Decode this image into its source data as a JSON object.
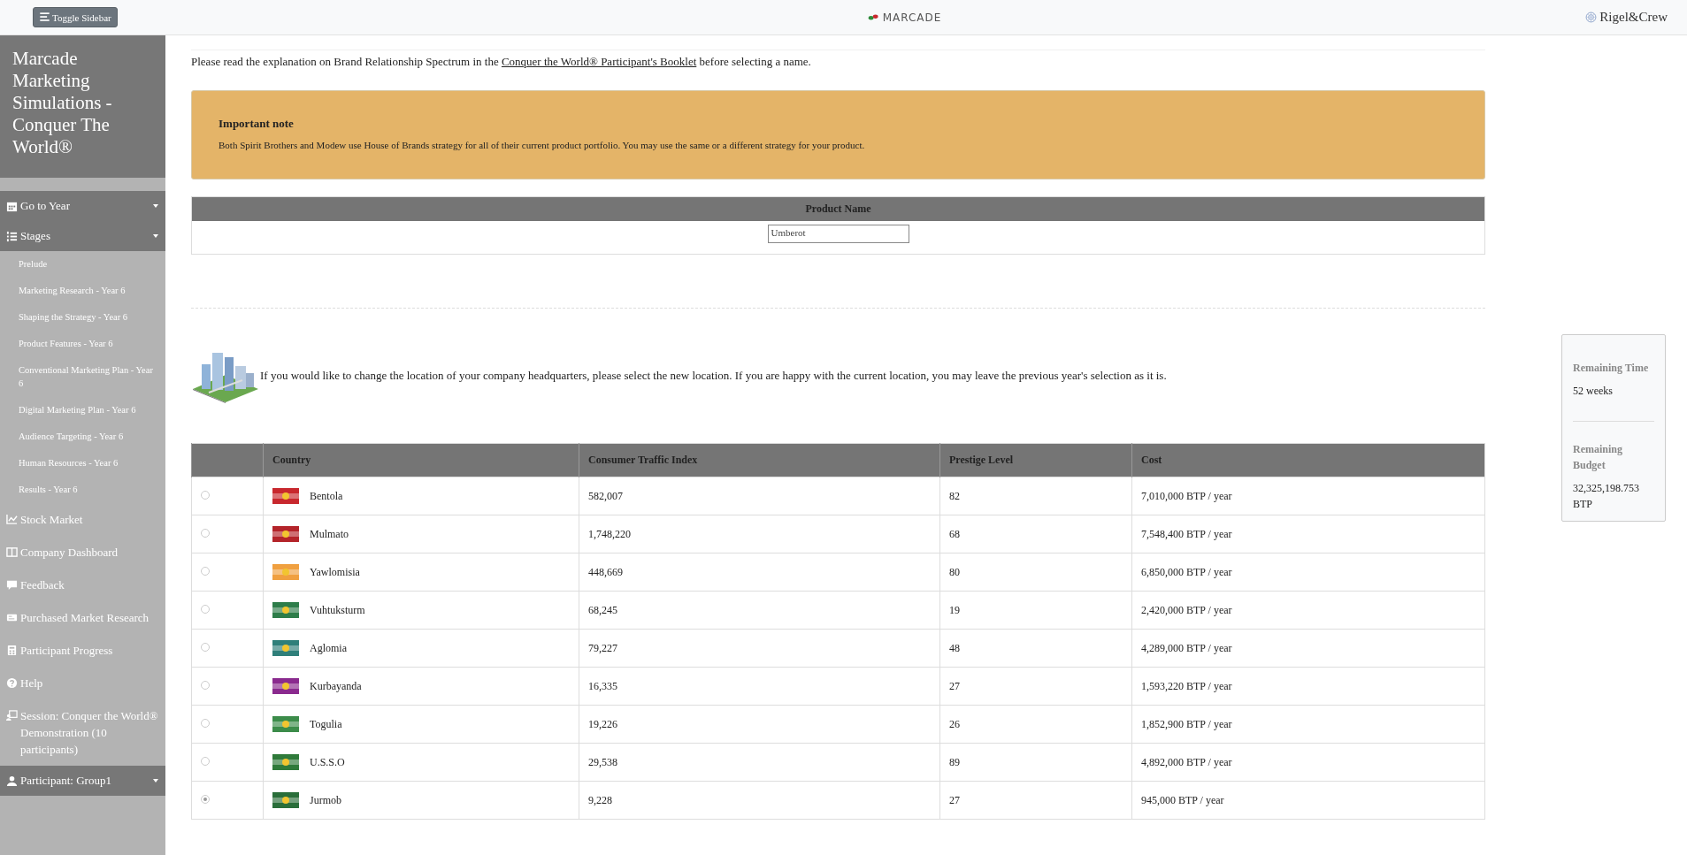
{
  "topbar": {
    "toggle_button": "Toggle Sidebar",
    "logo": "MARCADE",
    "brand": "Rigel&Crew"
  },
  "sidebar": {
    "title": "Marcade Marketing Simulations - Conquer The World®",
    "items": [
      {
        "kind": "dropdown",
        "label": "Go to Year"
      },
      {
        "kind": "dropdown",
        "label": "Stages",
        "children": [
          {
            "label": "Prelude"
          },
          {
            "label": "Marketing Research - Year 6"
          },
          {
            "label": "Shaping the Strategy - Year 6"
          },
          {
            "label": "Product Features - Year 6"
          },
          {
            "label": "Conventional Marketing Plan - Year 6"
          },
          {
            "label": "Digital Marketing Plan - Year 6"
          },
          {
            "label": "Audience Targeting - Year 6"
          },
          {
            "label": "Human Resources - Year 6"
          },
          {
            "label": "Results - Year 6"
          }
        ]
      },
      {
        "kind": "link",
        "label": "Stock Market"
      },
      {
        "kind": "link",
        "label": "Company Dashboard"
      },
      {
        "kind": "link",
        "label": "Feedback"
      },
      {
        "kind": "link",
        "label": "Purchased Market Research"
      },
      {
        "kind": "link",
        "label": "Participant Progress"
      },
      {
        "kind": "link",
        "label": "Help"
      },
      {
        "kind": "link",
        "label": "Session: Conquer the World® Demonstration (10 participants)"
      },
      {
        "kind": "dropdown",
        "label": "Participant: Group1"
      }
    ]
  },
  "intro": {
    "before": "Please read the explanation on Brand Relationship Spectrum in the ",
    "link": "Conquer the World® Participant's Booklet",
    "after": " before selecting a name."
  },
  "note": {
    "title": "Important note",
    "text": "Both Spirit Brothers and Modew use House of Brands strategy for all of their current product portfolio. You may use the same or a different strategy for your product."
  },
  "product_name": {
    "header": "Product Name",
    "value": "Umberot"
  },
  "headquarters": {
    "text": "If you would like to change the location of your company headquarters, please select the new location. If you are happy with the current location, you may leave the previous year's selection as it is.",
    "columns": [
      "Country",
      "Consumer Traffic Index",
      "Prestige Level",
      "Cost"
    ],
    "rows": [
      {
        "selected": false,
        "color": "#c8282e",
        "country": "Bentola",
        "traffic": "582,007",
        "prestige": "82",
        "cost": "7,010,000 BTP / year"
      },
      {
        "selected": false,
        "color": "#b4242a",
        "country": "Mulmato",
        "traffic": "1,748,220",
        "prestige": "68",
        "cost": "7,548,400 BTP / year"
      },
      {
        "selected": false,
        "color": "#f0a040",
        "country": "Yawlomisia",
        "traffic": "448,669",
        "prestige": "80",
        "cost": "6,850,000 BTP / year"
      },
      {
        "selected": false,
        "color": "#2e7d4a",
        "country": "Vuhtuksturm",
        "traffic": "68,245",
        "prestige": "19",
        "cost": "2,420,000 BTP / year"
      },
      {
        "selected": false,
        "color": "#2f7f7a",
        "country": "Aglomia",
        "traffic": "79,227",
        "prestige": "48",
        "cost": "4,289,000 BTP / year"
      },
      {
        "selected": false,
        "color": "#8a2a8e",
        "country": "Kurbayanda",
        "traffic": "16,335",
        "prestige": "27",
        "cost": "1,593,220 BTP / year"
      },
      {
        "selected": false,
        "color": "#3c8c4a",
        "country": "Togulia",
        "traffic": "19,226",
        "prestige": "26",
        "cost": "1,852,900 BTP / year"
      },
      {
        "selected": false,
        "color": "#2f7a3a",
        "country": "U.S.S.O",
        "traffic": "29,538",
        "prestige": "89",
        "cost": "4,892,000 BTP / year"
      },
      {
        "selected": true,
        "color": "#2a6e3a",
        "country": "Jurmob",
        "traffic": "9,228",
        "prestige": "27",
        "cost": "945,000 BTP / year"
      }
    ]
  },
  "status_panel": {
    "time_label": "Remaining Time",
    "time_value": "52 weeks",
    "budget_label": "Remaining Budget",
    "budget_value": "32,325,198.753 BTP"
  }
}
